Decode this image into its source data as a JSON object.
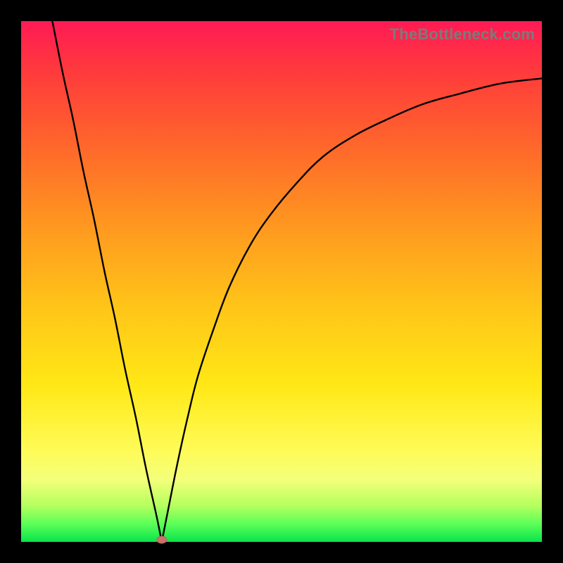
{
  "watermark": "TheBottleneck.com",
  "colors": {
    "frame_bg": "#000000",
    "gradient_top": "#ff1a55",
    "gradient_bottom": "#08e44a",
    "curve_stroke": "#000000",
    "min_marker": "#c9726a"
  },
  "chart_data": {
    "type": "line",
    "title": "",
    "xlabel": "",
    "ylabel": "",
    "xlim": [
      0,
      100
    ],
    "ylim": [
      0,
      100
    ],
    "grid": false,
    "legend": false,
    "annotations": [
      {
        "text": "TheBottleneck.com",
        "role": "watermark",
        "position": "top-right"
      }
    ],
    "min_marker": {
      "x": 27,
      "y": 0
    },
    "series": [
      {
        "name": "left-branch",
        "x": [
          6,
          8,
          10,
          12,
          14,
          16,
          18,
          20,
          22,
          24,
          26,
          27
        ],
        "y": [
          100,
          90,
          81,
          71,
          62,
          52,
          43,
          33,
          24,
          14,
          5,
          0
        ]
      },
      {
        "name": "right-branch",
        "x": [
          27,
          28,
          30,
          32,
          34,
          37,
          40,
          44,
          48,
          53,
          58,
          64,
          70,
          77,
          84,
          92,
          100
        ],
        "y": [
          0,
          5,
          15,
          24,
          32,
          41,
          49,
          57,
          63,
          69,
          74,
          78,
          81,
          84,
          86,
          88,
          89
        ]
      }
    ]
  }
}
